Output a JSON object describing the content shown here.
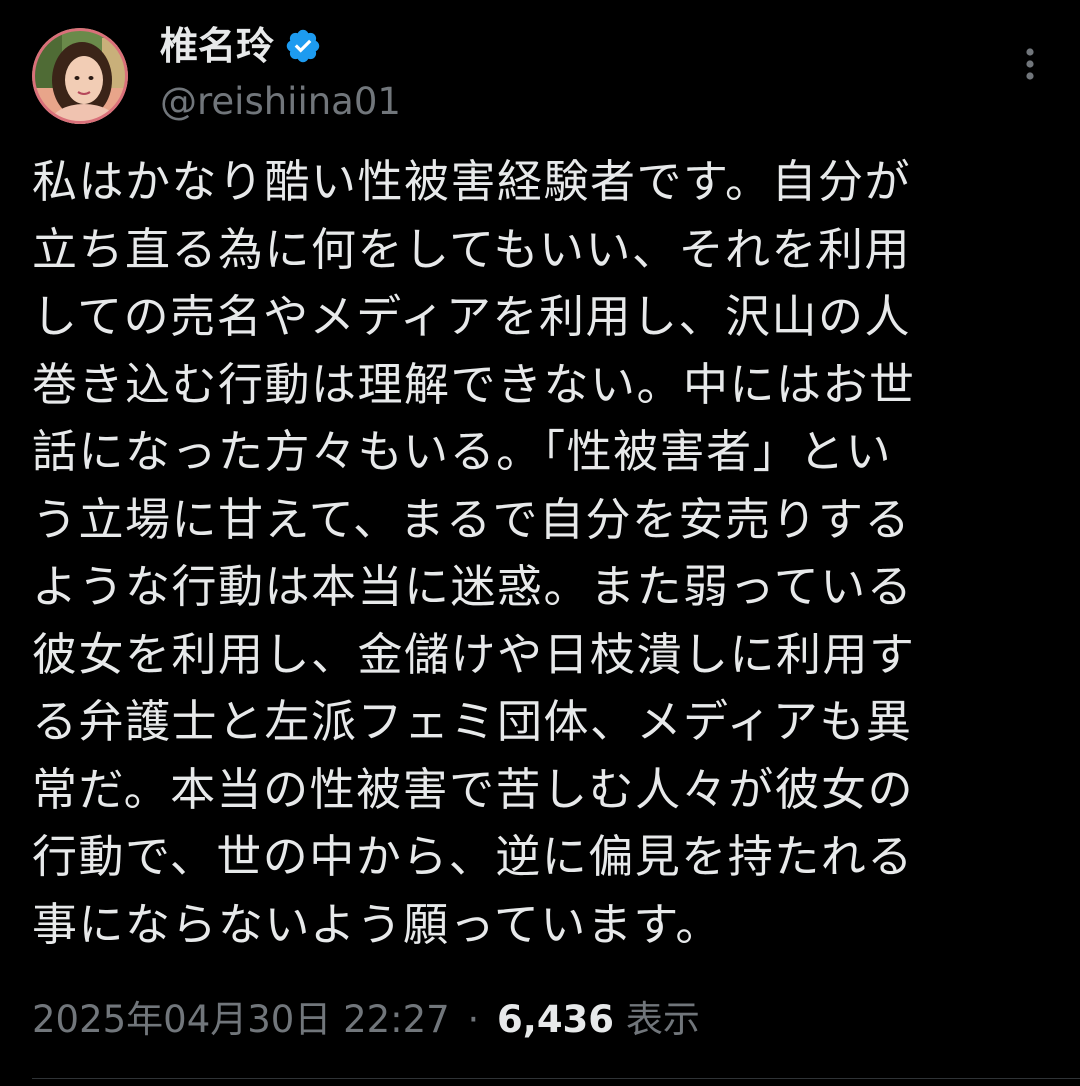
{
  "user": {
    "display_name": "椎名玲",
    "handle": "@reishiina01",
    "verified_icon": "verified-badge-icon",
    "verified_color": "#1d9bf0"
  },
  "more_icon": "more-vertical-icon",
  "tweet": {
    "lines": [
      "私はかなり酷い性被害経験者です。自分が",
      "立ち直る為に何をしてもいい、それを利用",
      "しての売名やメディアを利用し、沢山の人",
      "巻き込む行動は理解できない。中にはお世",
      "話になった方々もいる。「性被害者」とい",
      "う立場に甘えて、まるで自分を安売りする",
      "ような行動は本当に迷惑。また弱っている",
      "彼女を利用し、金儲けや日枝潰しに利用す",
      "る弁護士と左派フェミ団体、メディアも異",
      "常だ。本当の性被害で苦しむ人々が彼女の",
      "行動で、世の中から、逆に偏見を持たれる",
      "事にならないよう願っています。"
    ]
  },
  "meta": {
    "timestamp": "2025年04月30日 22:27",
    "separator": "·",
    "views_count": "6,436",
    "views_label": "表示"
  }
}
